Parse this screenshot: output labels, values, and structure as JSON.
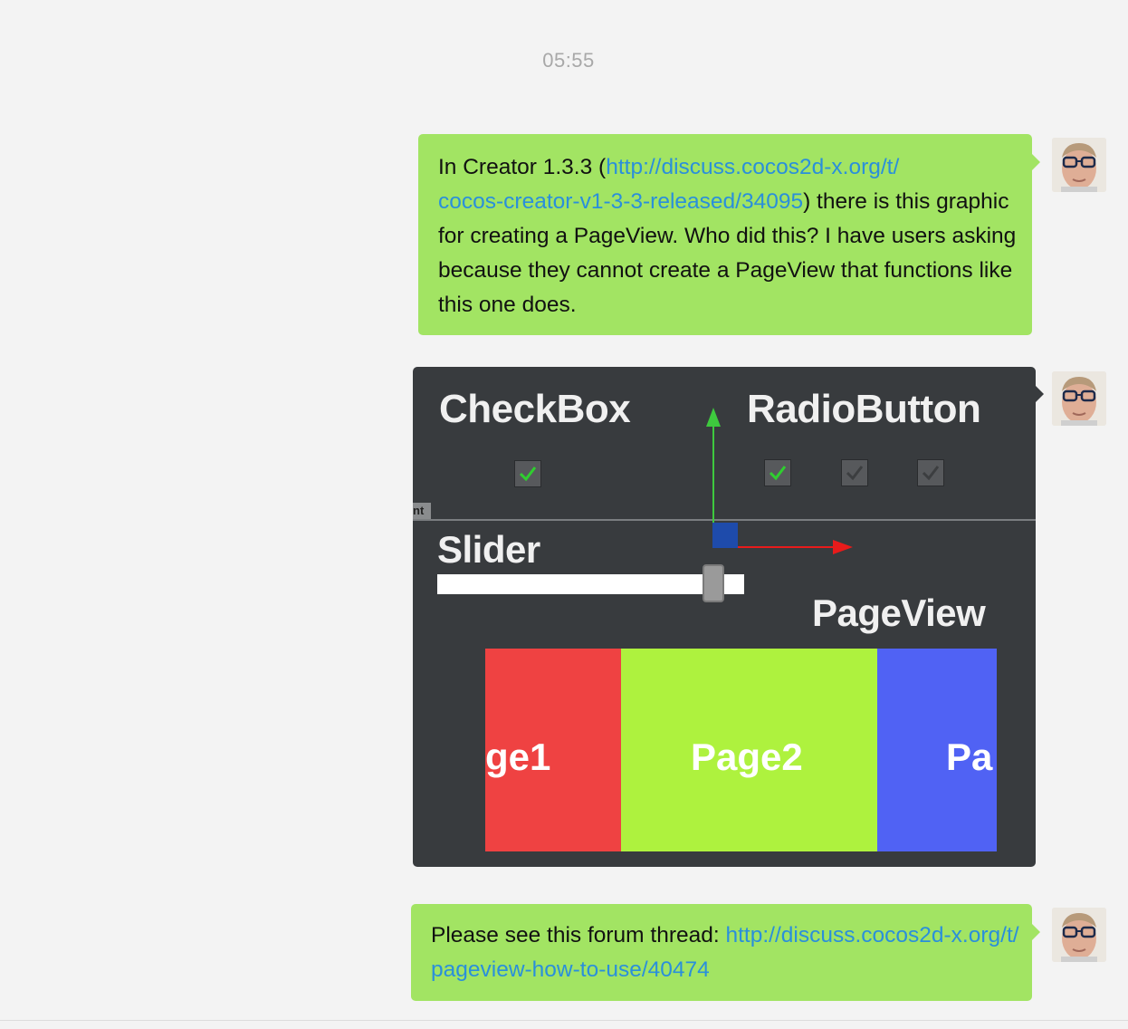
{
  "timestamp": "05:55",
  "messages": {
    "first": {
      "prefix": "In Creator 1.3.3 (",
      "link_line1": "http://discuss.cocos2d-x.org/t/",
      "link_line2": "cocos-creator-v1-3-3-released/34095",
      "suffix": ") there is this graphic for creating a PageView. Who did this? I have users asking because they cannot create a PageView that functions like this one does."
    },
    "image": {
      "checkbox_label": "CheckBox",
      "radio_label": "RadioButton",
      "slider_label": "Slider",
      "pageview_label": "PageView",
      "node_tag": "nt",
      "slider_value": 0.9,
      "pages": [
        {
          "label": "ge1",
          "color": "#ef4242"
        },
        {
          "label": "Page2",
          "color": "#aef23e"
        },
        {
          "label": "Pa",
          "color": "#5062f4"
        }
      ],
      "colors": {
        "background": "#383b3e",
        "check": "#2fce2f",
        "y_axis": "#3ec93e",
        "x_axis": "#e81b1b",
        "origin": "#1e4bab"
      }
    },
    "third": {
      "prefix": "Please see this forum thread: ",
      "link": "http://discuss.cocos2d-x.org/t/pageview-how-to-use/40474"
    }
  },
  "colors": {
    "bubble": "#a2e463",
    "link": "#2a8fdb",
    "chat_background": "#f3f3f3"
  }
}
